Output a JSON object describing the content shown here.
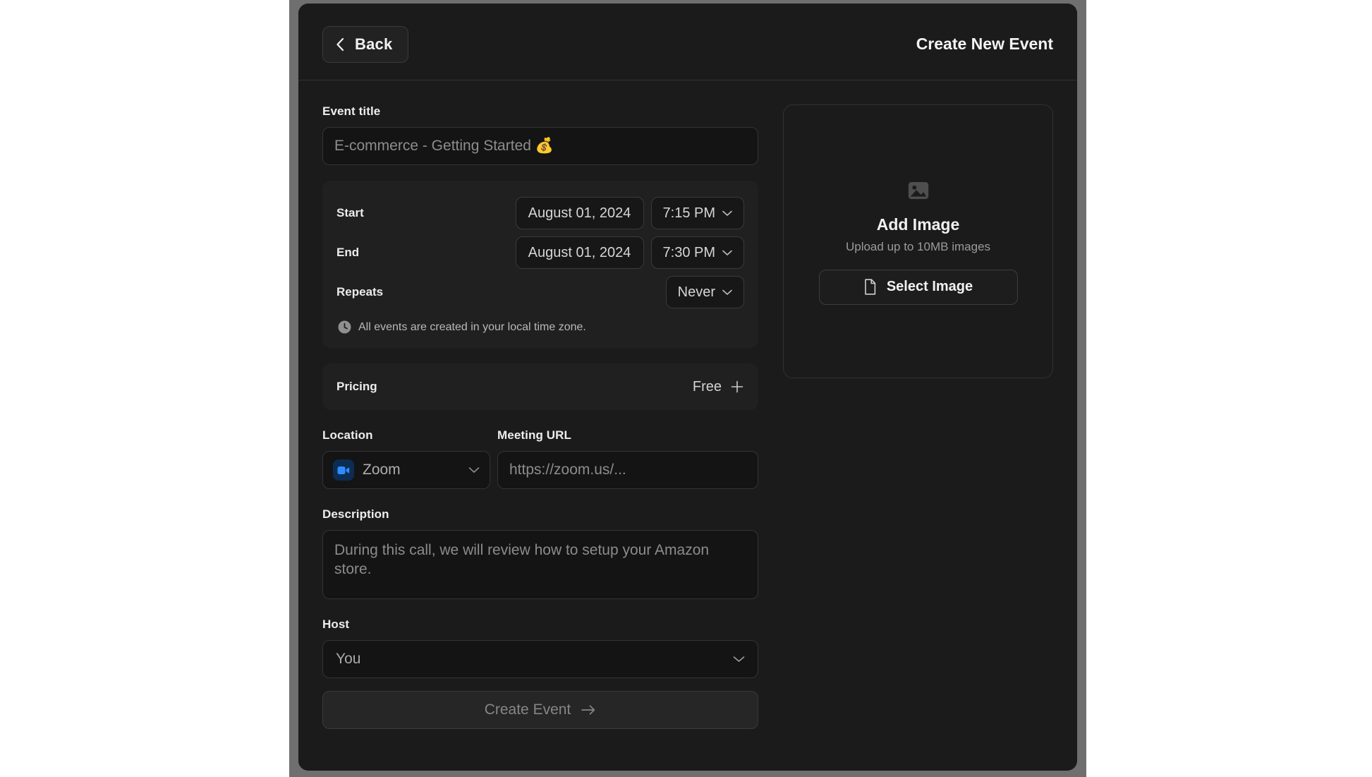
{
  "header": {
    "back_label": "Back",
    "back_icon": "chevron-left-icon",
    "title": "Create New Event"
  },
  "form": {
    "event_title": {
      "label": "Event title",
      "value": "",
      "placeholder": "E-commerce - Getting Started 💰"
    },
    "schedule": {
      "start": {
        "label": "Start",
        "date": "August 01, 2024",
        "time": "7:15 PM"
      },
      "end": {
        "label": "End",
        "date": "August 01, 2024",
        "time": "7:30 PM"
      },
      "repeats": {
        "label": "Repeats",
        "value": "Never"
      },
      "timezone_note": "All events are created in your local time zone.",
      "timezone_icon": "clock-icon"
    },
    "pricing": {
      "label": "Pricing",
      "value": "Free",
      "add_icon": "plus-icon"
    },
    "location": {
      "label": "Location",
      "value": "Zoom",
      "icon": "zoom-icon",
      "chevron_icon": "chevron-down-icon"
    },
    "meeting_url": {
      "label": "Meeting URL",
      "value": "",
      "placeholder": "https://zoom.us/..."
    },
    "description": {
      "label": "Description",
      "value": "",
      "placeholder": "During this call, we will review how to setup your Amazon store."
    },
    "host": {
      "label": "Host",
      "value": "You",
      "chevron_icon": "chevron-down-icon"
    },
    "submit": {
      "label": "Create Event",
      "icon": "arrow-right-icon"
    }
  },
  "image_panel": {
    "placeholder_icon": "image-icon",
    "title": "Add Image",
    "subtitle": "Upload up to 10MB images",
    "select_label": "Select Image",
    "select_icon": "file-icon"
  },
  "colors": {
    "modal_background": "#1b1b1b",
    "card_background": "#202020",
    "input_background": "#141414",
    "border": "#343434",
    "accent_zoom": "#2d8cff",
    "text_primary": "#f2f2f2",
    "text_muted": "#8d8d8d"
  }
}
